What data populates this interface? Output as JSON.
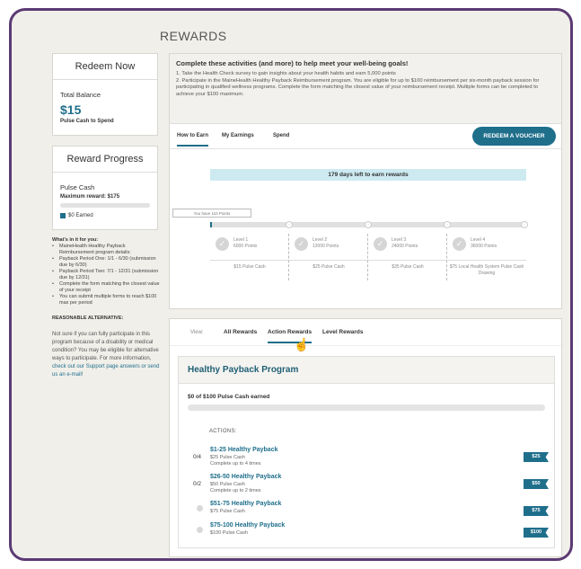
{
  "page": {
    "title": "REWARDS"
  },
  "redeem_card": {
    "heading": "Redeem Now",
    "balance_label": "Total Balance",
    "balance_amount": "$15",
    "balance_sub": "Pulse Cash to Spend"
  },
  "progress_card": {
    "heading": "Reward Progress",
    "label": "Pulse Cash",
    "max": "Maximum reward: $175",
    "earned": "$0 Earned",
    "progress_fraction": 0
  },
  "side": {
    "heading": "What's in it for you:",
    "items": [
      "MaineHealth Healthy Payback Reimbursement program details:",
      "Payback Period One: 1/1 - 6/30 (submission due by 6/30)",
      "Payback Period Two: 7/1 - 12/31 (submission due by 12/31)",
      "Complete the form matching the closest value of your receipt",
      "You can submit multiple forms to reach $100 max per period"
    ],
    "alt_heading": "REASONABLE ALTERNATIVE:",
    "alt_text": "Not sure if you can fully participate in this program because of a disability or medical condition? You may be eligible for alternative ways to participate. For more information, ",
    "alt_link": "check out our Support page answers or send us an e-mail!"
  },
  "intro": {
    "title": "Complete these activities (and more) to help meet your well-being goals!",
    "line1": "1. Take the Health Check survey to gain insights about your health habits and earn 5,000 points",
    "line2": "2. Participate in the MaineHealth Healthy Payback Reimbursement program. You are eligible for up to $100 reimbursement per six-month payback session for participating in qualified wellness programs. Complete the form matching the closest value of your reimbursement receipt. Multiple forms can be completed to achieve your $100 maximum."
  },
  "tabs": [
    "How to Earn",
    "My Earnings",
    "Spend"
  ],
  "redeem_button": "REDEEM A VOUCHER",
  "days_left": "179 days left to earn rewards",
  "tooltip": "You have 110 Points",
  "levels": [
    {
      "name": "Level 1",
      "points": "6000 Points",
      "reward": "$15 Pulse Cash"
    },
    {
      "name": "Level 2",
      "points": "12000 Points",
      "reward": "$25 Pulse Cash"
    },
    {
      "name": "Level 3",
      "points": "24000 Points",
      "reward": "$35 Pulse Cash"
    },
    {
      "name": "Level 4",
      "points": "36000 Points",
      "reward": "$75 Local Health System Pulse Cash Drawing"
    }
  ],
  "view": {
    "label": "View:",
    "tabs": [
      "All Rewards",
      "Action Rewards",
      "Level Rewards"
    ]
  },
  "program": {
    "title": "Healthy Payback Program",
    "earned": "$0 of $100 Pulse Cash earned",
    "actions_heading": "ACTIONS:",
    "actions": [
      {
        "count": "0/4",
        "title": "$1-25 Healthy Payback",
        "cash": "$25 Pulse Cash",
        "note": "Complete up to 4 times",
        "tag": "$25"
      },
      {
        "count": "0/2",
        "title": "$26-50 Healthy Payback",
        "cash": "$50 Pulse Cash",
        "note": "Complete up to 2 times",
        "tag": "$50"
      },
      {
        "count": "",
        "title": "$51-75 Healthy Payback",
        "cash": "$75 Pulse Cash",
        "note": "",
        "tag": "$75"
      },
      {
        "count": "",
        "title": "$75-100 Healthy Payback",
        "cash": "$100 Pulse Cash",
        "note": "",
        "tag": "$100"
      }
    ]
  },
  "colors": {
    "accent": "#1f6f8b",
    "frame": "#5b3a73",
    "banner": "#cdeaf1"
  }
}
